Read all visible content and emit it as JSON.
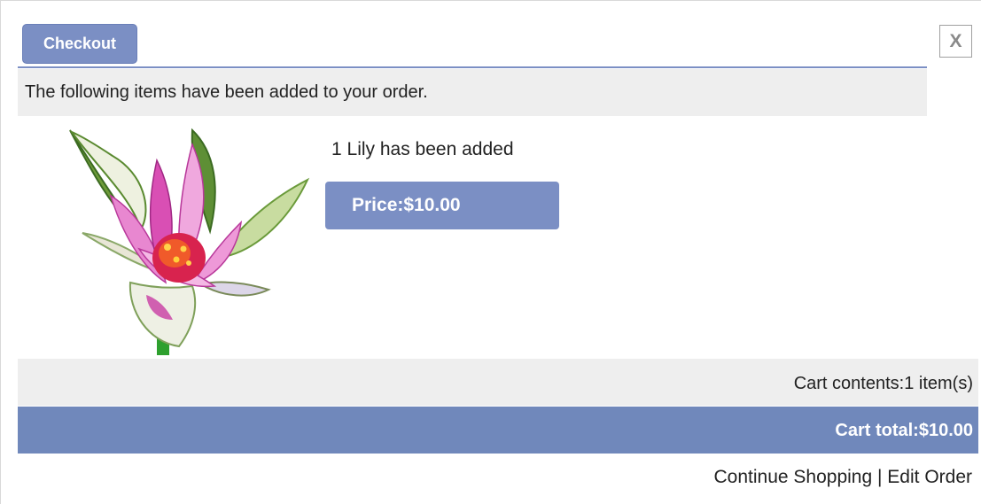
{
  "header": {
    "checkout_label": "Checkout",
    "close_label": "X"
  },
  "notice": {
    "text": "The following items have been added to your order."
  },
  "product": {
    "added_text": "1 Lily has been added",
    "price_text": "Price:$10.00",
    "image_icon": "lily-flower-image"
  },
  "cart": {
    "contents_text": "Cart contents:1 item(s)",
    "total_text": "Cart total:$10.00"
  },
  "footer": {
    "continue_label": "Continue Shopping",
    "separator": " | ",
    "edit_label": "Edit Order"
  },
  "colors": {
    "accent": "#7b8fc4",
    "total_bar": "#7088bb",
    "panel_gray": "#eeeeee"
  }
}
